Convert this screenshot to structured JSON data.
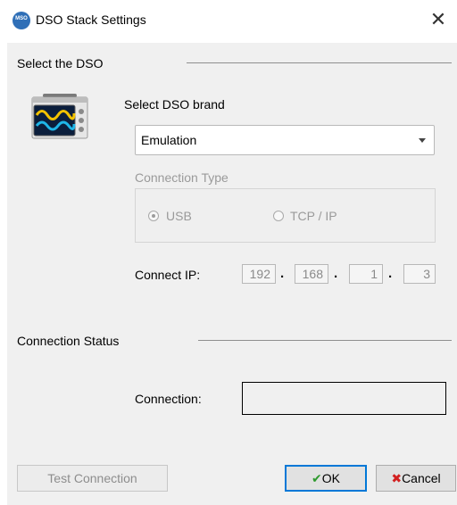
{
  "window": {
    "title": "DSO Stack Settings",
    "icon_text": "MSO",
    "close_glyph": "✕"
  },
  "select_dso": {
    "section_title": "Select the DSO",
    "brand_label": "Select DSO brand",
    "brand_value": "Emulation",
    "connection_type_label": "Connection Type",
    "radio_usb": {
      "label": "USB",
      "selected": true
    },
    "radio_tcp": {
      "label": "TCP / IP",
      "selected": false
    },
    "ip_label": "Connect IP:",
    "ip_octets": [
      "192",
      "168",
      "1",
      "3"
    ],
    "ip_separator": "."
  },
  "connection_status": {
    "section_title": "Connection Status",
    "connection_label": "Connection:",
    "connection_value": ""
  },
  "buttons": {
    "test_label": "Test Connection",
    "ok_label": "OK",
    "cancel_label": "Cancel",
    "ok_icon": "check-icon",
    "cancel_icon": "x-icon"
  },
  "colors": {
    "accent": "#0078d7",
    "ok_check": "#2e9a2e",
    "cancel_x": "#d22020",
    "scope_screen": "#0b1e3c",
    "scope_body": "#e6e6e6",
    "wave_yellow": "#f2c200",
    "wave_cyan": "#1fb6e8"
  }
}
